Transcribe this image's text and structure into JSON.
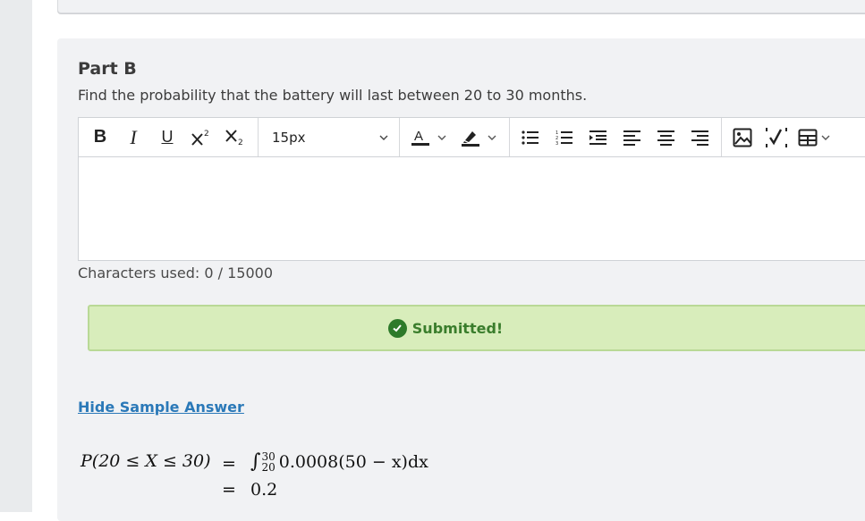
{
  "part": {
    "title": "Part B",
    "question": "Find the probability that the battery will last between 20 to 30 months."
  },
  "toolbar": {
    "bold_label": "B",
    "italic_label": "I",
    "underline_label": "U",
    "font_size": "15px",
    "icons": [
      "bold-icon",
      "italic-icon",
      "underline-icon",
      "superscript-icon",
      "subscript-icon",
      "font-color-icon",
      "highlight-icon",
      "bullet-list-icon",
      "numbered-list-icon",
      "indent-icon",
      "align-left-icon",
      "align-center-icon",
      "align-right-icon",
      "image-icon",
      "math-icon",
      "table-icon"
    ]
  },
  "editor": {
    "content": "",
    "char_count_text": "Characters used: 0 / 15000"
  },
  "status": {
    "text": "Submitted!",
    "color": "#3a7d2c",
    "background": "#d8edbb"
  },
  "sample_answer": {
    "toggle_label": "Hide Sample Answer",
    "line1_lhs": "P(20 ≤ X ≤ 30)",
    "eq": "=",
    "upper_limit": "30",
    "lower_limit": "20",
    "integrand": "0.0008(50 − x)dx",
    "result": "0.2"
  },
  "colors": {
    "link": "#2b79b8",
    "card": "#f1f2f4",
    "rail": "#e9ebed"
  }
}
